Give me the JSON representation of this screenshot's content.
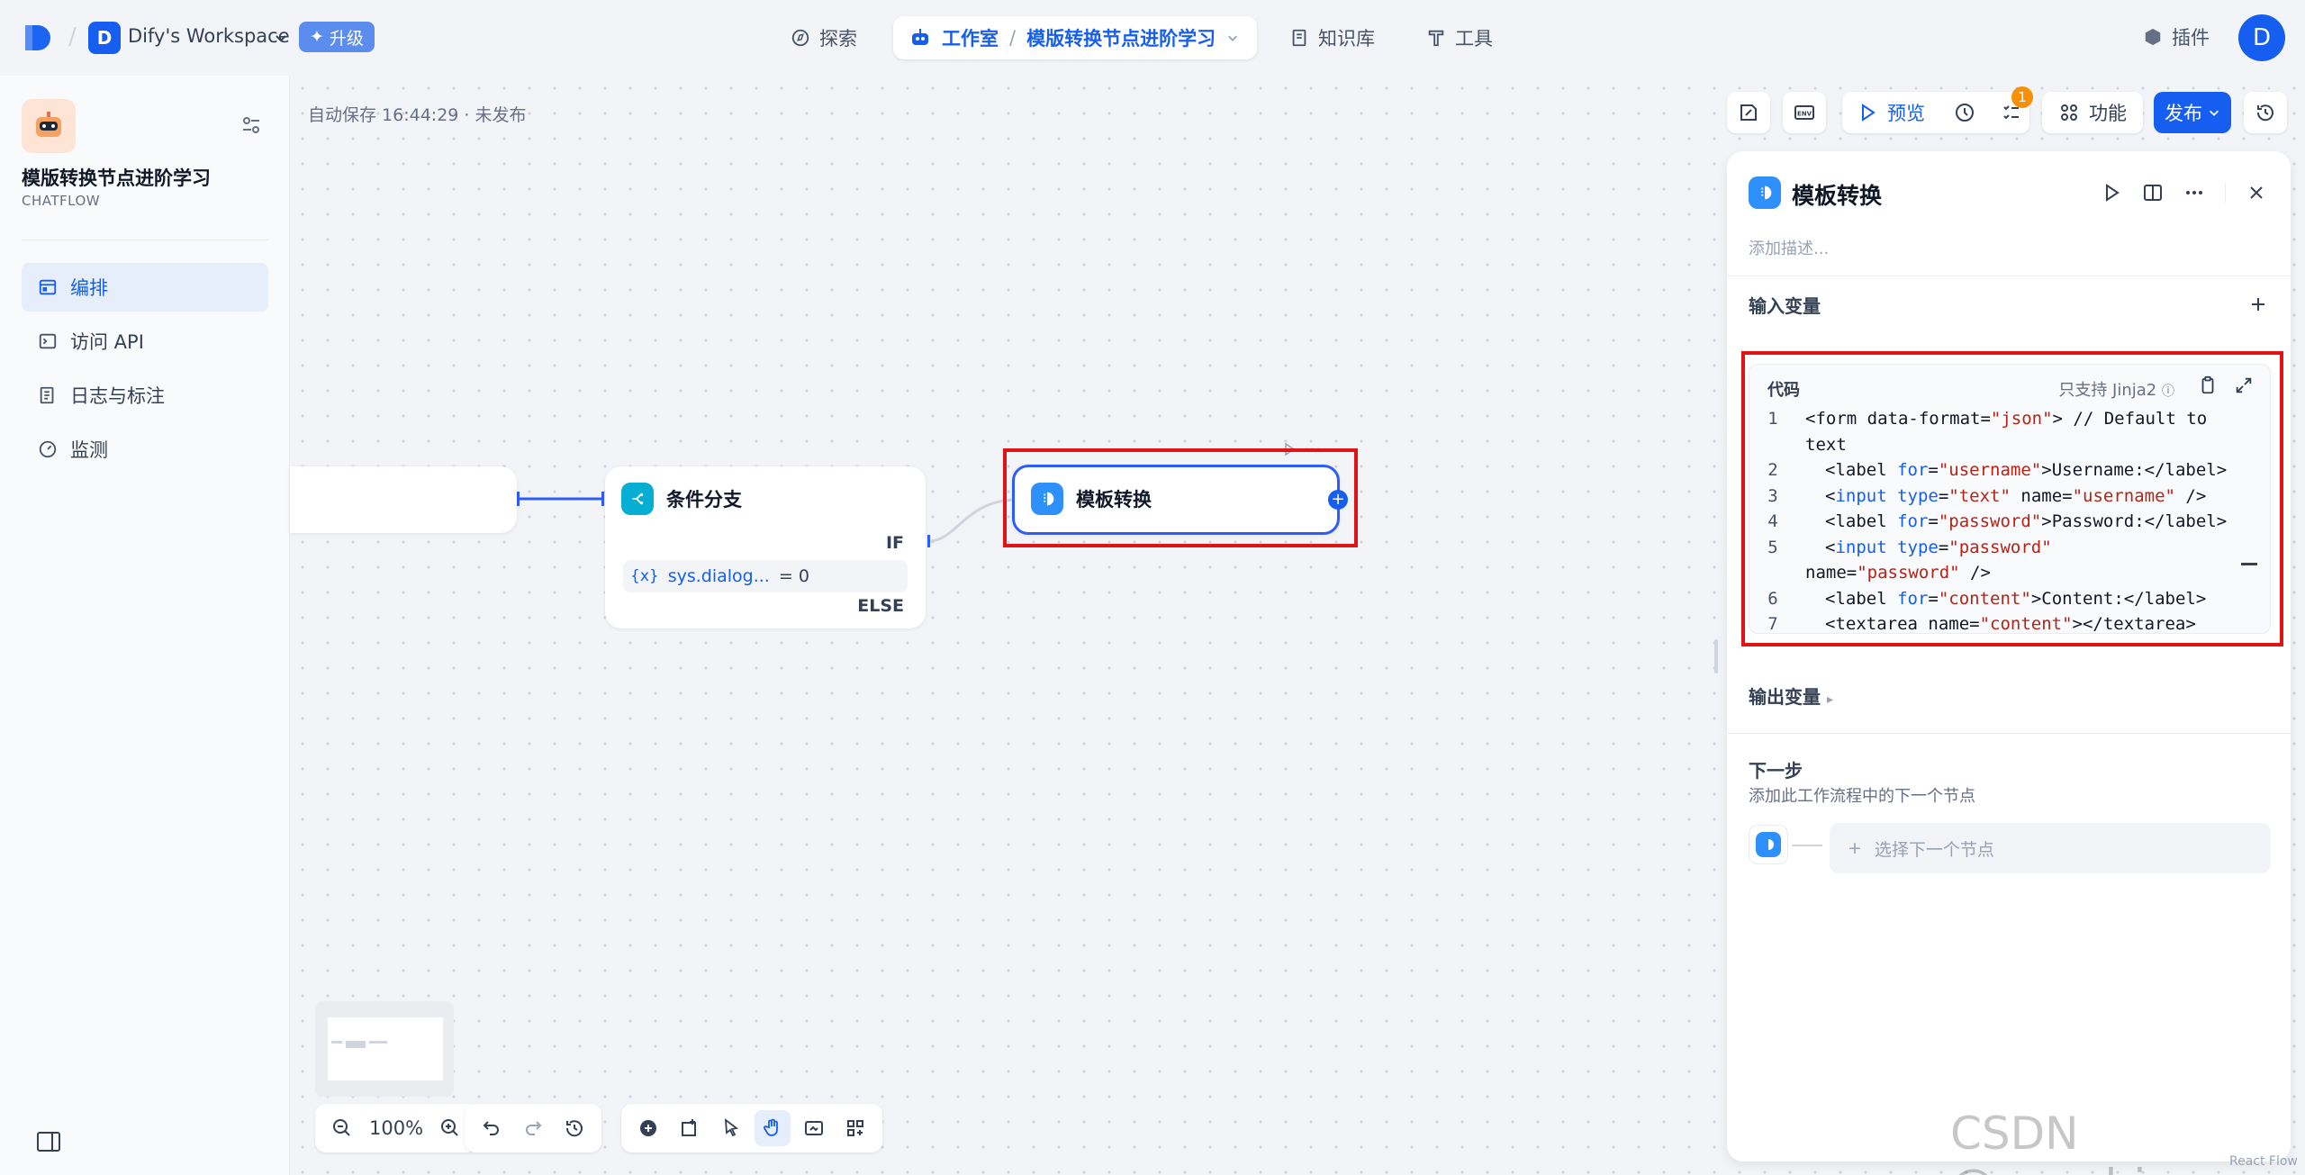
{
  "header": {
    "workspace_initial": "D",
    "workspace_name": "Dify's Workspace",
    "upgrade_label": "升级",
    "nav": {
      "explore": "探索",
      "studio": "工作室",
      "app_name": "模版转换节点进阶学习",
      "knowledge": "知识库",
      "tools": "工具",
      "plugins": "插件"
    },
    "user_initial": "D"
  },
  "sidebar": {
    "app_name": "模版转换节点进阶学习",
    "app_type": "CHATFLOW",
    "items": [
      {
        "label": "编排",
        "active": true
      },
      {
        "label": "访问 API",
        "active": false
      },
      {
        "label": "日志与标注",
        "active": false
      },
      {
        "label": "监测",
        "active": false
      }
    ]
  },
  "canvas": {
    "autosave": "自动保存 16:44:29 · 未发布",
    "toolbar": {
      "preview_label": "预览",
      "checklist_badge": "1",
      "features_label": "功能",
      "publish_label": "发布"
    },
    "if_node": {
      "title": "条件分支",
      "if_label": "IF",
      "condition_var": "sys.dialog...",
      "condition_op": "= 0",
      "else_label": "ELSE"
    },
    "template_node": {
      "title": "模板转换"
    },
    "zoom_level": "100%"
  },
  "panel": {
    "title": "模板转换",
    "description_placeholder": "添加描述...",
    "input_vars_title": "输入变量",
    "code": {
      "label": "代码",
      "note": "只支持 Jinja2",
      "line_numbers": [
        "1",
        "2",
        "3",
        "4",
        "5",
        "6",
        "7"
      ]
    },
    "output_vars_title": "输出变量",
    "next_step_title": "下一步",
    "next_step_desc": "添加此工作流程中的下一个节点",
    "next_step_placeholder": "选择下一个节点"
  },
  "watermark": "CSDN @engchina",
  "attribution": "React Flow",
  "colors": {
    "accent": "#155eef",
    "highlight_box": "#e01414",
    "if_node_icon": "#06aed4",
    "template_icon": "#2e90fa"
  }
}
